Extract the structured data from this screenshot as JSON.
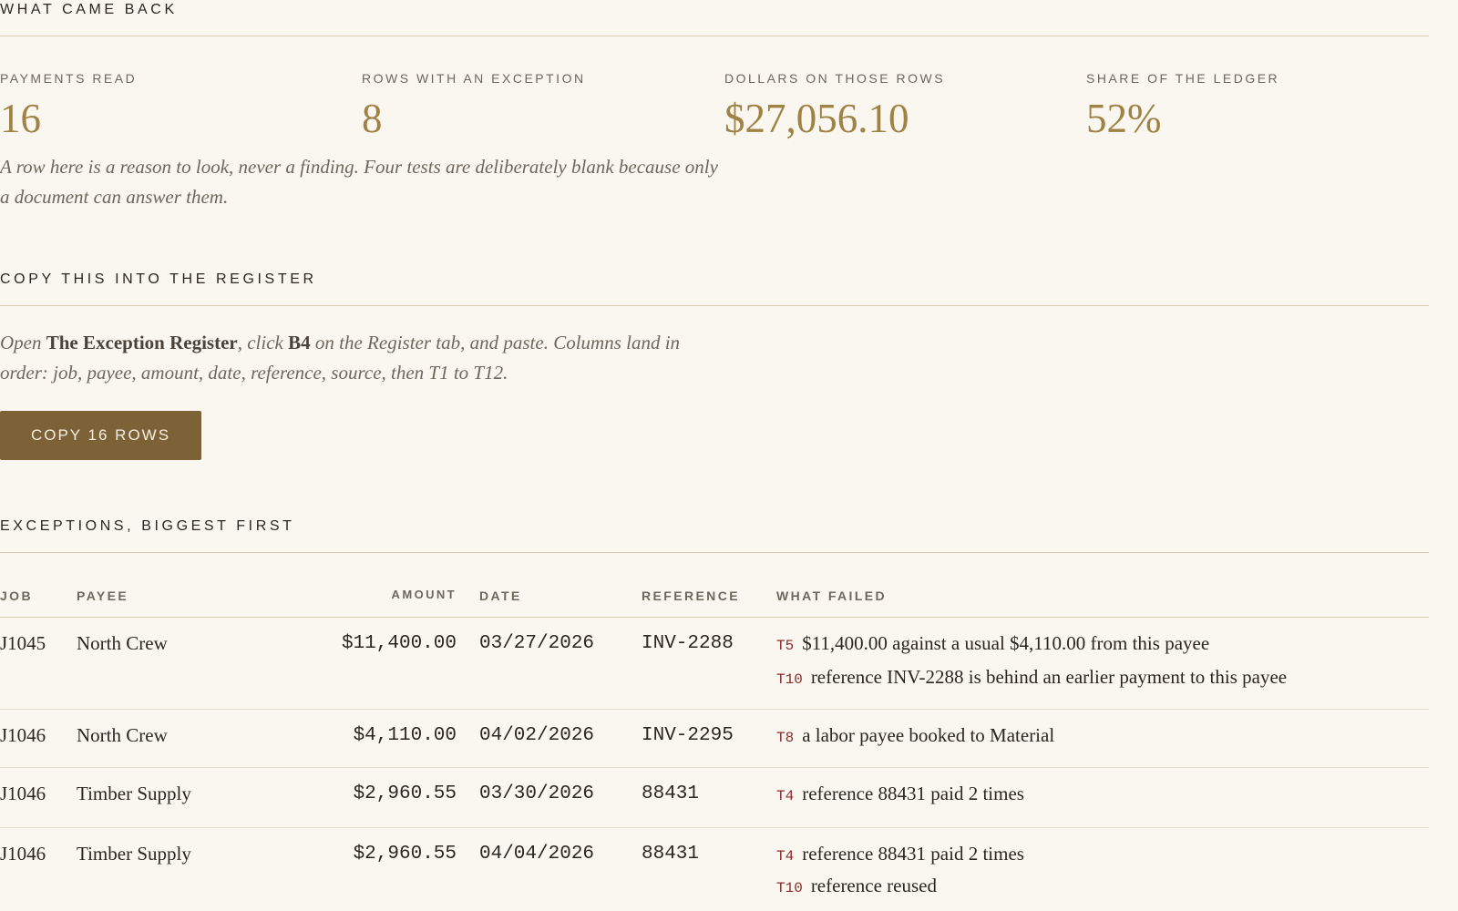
{
  "summary": {
    "heading": "WHAT CAME BACK",
    "stats": [
      {
        "label": "PAYMENTS READ",
        "value": "16"
      },
      {
        "label": "ROWS WITH AN EXCEPTION",
        "value": "8"
      },
      {
        "label": "DOLLARS ON THOSE ROWS",
        "value": "$27,056.10"
      },
      {
        "label": "SHARE OF THE LEDGER",
        "value": "52%"
      }
    ],
    "note": "A row here is a reason to look, never a finding. Four tests are deliberately blank because only a document can answer them."
  },
  "copy_section": {
    "heading": "COPY THIS INTO THE REGISTER",
    "instructions": {
      "part1": "Open ",
      "register_name": "The Exception Register",
      "part2": ", click ",
      "cell": "B4",
      "part3": " on the Register tab, and paste. Columns land in order: job, payee, amount, date, reference, source, then T1 to T12."
    },
    "button_label": "COPY 16 ROWS"
  },
  "exceptions": {
    "heading": "EXCEPTIONS, BIGGEST FIRST",
    "columns": {
      "job": "JOB",
      "payee": "PAYEE",
      "amount": "AMOUNT",
      "date": "DATE",
      "reference": "REFERENCE",
      "what_failed": "WHAT FAILED"
    },
    "rows": [
      {
        "job": "J1045",
        "payee": "North Crew",
        "amount": "$11,400.00",
        "date": "03/27/2026",
        "reference": "INV-2288",
        "failures": [
          {
            "code": "T5",
            "text": "$11,400.00 against a usual $4,110.00 from this payee"
          },
          {
            "code": "T10",
            "text": "reference INV-2288 is behind an earlier payment to this payee"
          }
        ]
      },
      {
        "job": "J1046",
        "payee": "North Crew",
        "amount": "$4,110.00",
        "date": "04/02/2026",
        "reference": "INV-2295",
        "failures": [
          {
            "code": "T8",
            "text": "a labor payee booked to Material"
          }
        ]
      },
      {
        "job": "J1046",
        "payee": "Timber Supply",
        "amount": "$2,960.55",
        "date": "03/30/2026",
        "reference": "88431",
        "failures": [
          {
            "code": "T4",
            "text": "reference 88431 paid 2 times"
          }
        ]
      },
      {
        "job": "J1046",
        "payee": "Timber Supply",
        "amount": "$2,960.55",
        "date": "04/04/2026",
        "reference": "88431",
        "failures": [
          {
            "code": "T4",
            "text": "reference 88431 paid 2 times"
          },
          {
            "code": "T10",
            "text": "reference reused"
          }
        ]
      }
    ]
  }
}
